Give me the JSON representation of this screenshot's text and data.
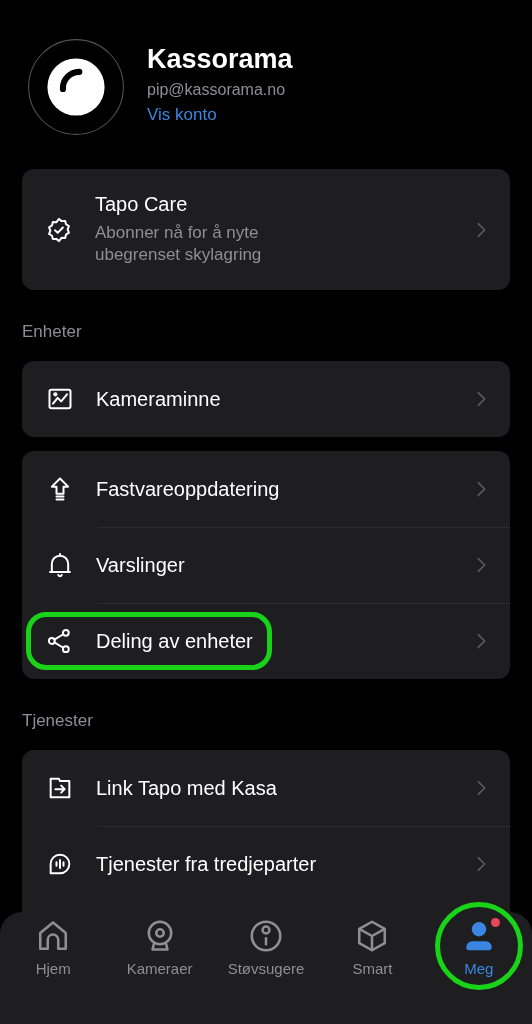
{
  "profile": {
    "name": "Kassorama",
    "email": "pip@kassorama.no",
    "link": "Vis konto"
  },
  "promo": {
    "title": "Tapo Care",
    "subtitle": "Abonner nå for å nyte ubegrenset skylagring"
  },
  "sections": [
    {
      "label": "Enheter",
      "cards": [
        {
          "items": [
            {
              "label": "Kameraminne",
              "highlighted": false
            }
          ]
        },
        {
          "items": [
            {
              "label": "Fastvareoppdatering",
              "highlighted": false
            },
            {
              "label": "Varslinger",
              "highlighted": false
            },
            {
              "label": "Deling av enheter",
              "highlighted": true
            }
          ]
        }
      ]
    },
    {
      "label": "Tjenester",
      "cards": [
        {
          "items": [
            {
              "label": "Link Tapo med Kasa",
              "highlighted": false
            },
            {
              "label": "Tjenester fra tredjeparter",
              "highlighted": false
            }
          ]
        }
      ]
    }
  ],
  "tabs": [
    {
      "label": "Hjem",
      "selected": false,
      "notification": false,
      "highlighted": false
    },
    {
      "label": "Kameraer",
      "selected": false,
      "notification": false,
      "highlighted": false
    },
    {
      "label": "Støvsugere",
      "selected": false,
      "notification": false,
      "highlighted": false
    },
    {
      "label": "Smart",
      "selected": false,
      "notification": false,
      "highlighted": false
    },
    {
      "label": "Meg",
      "selected": true,
      "notification": true,
      "highlighted": true
    }
  ]
}
